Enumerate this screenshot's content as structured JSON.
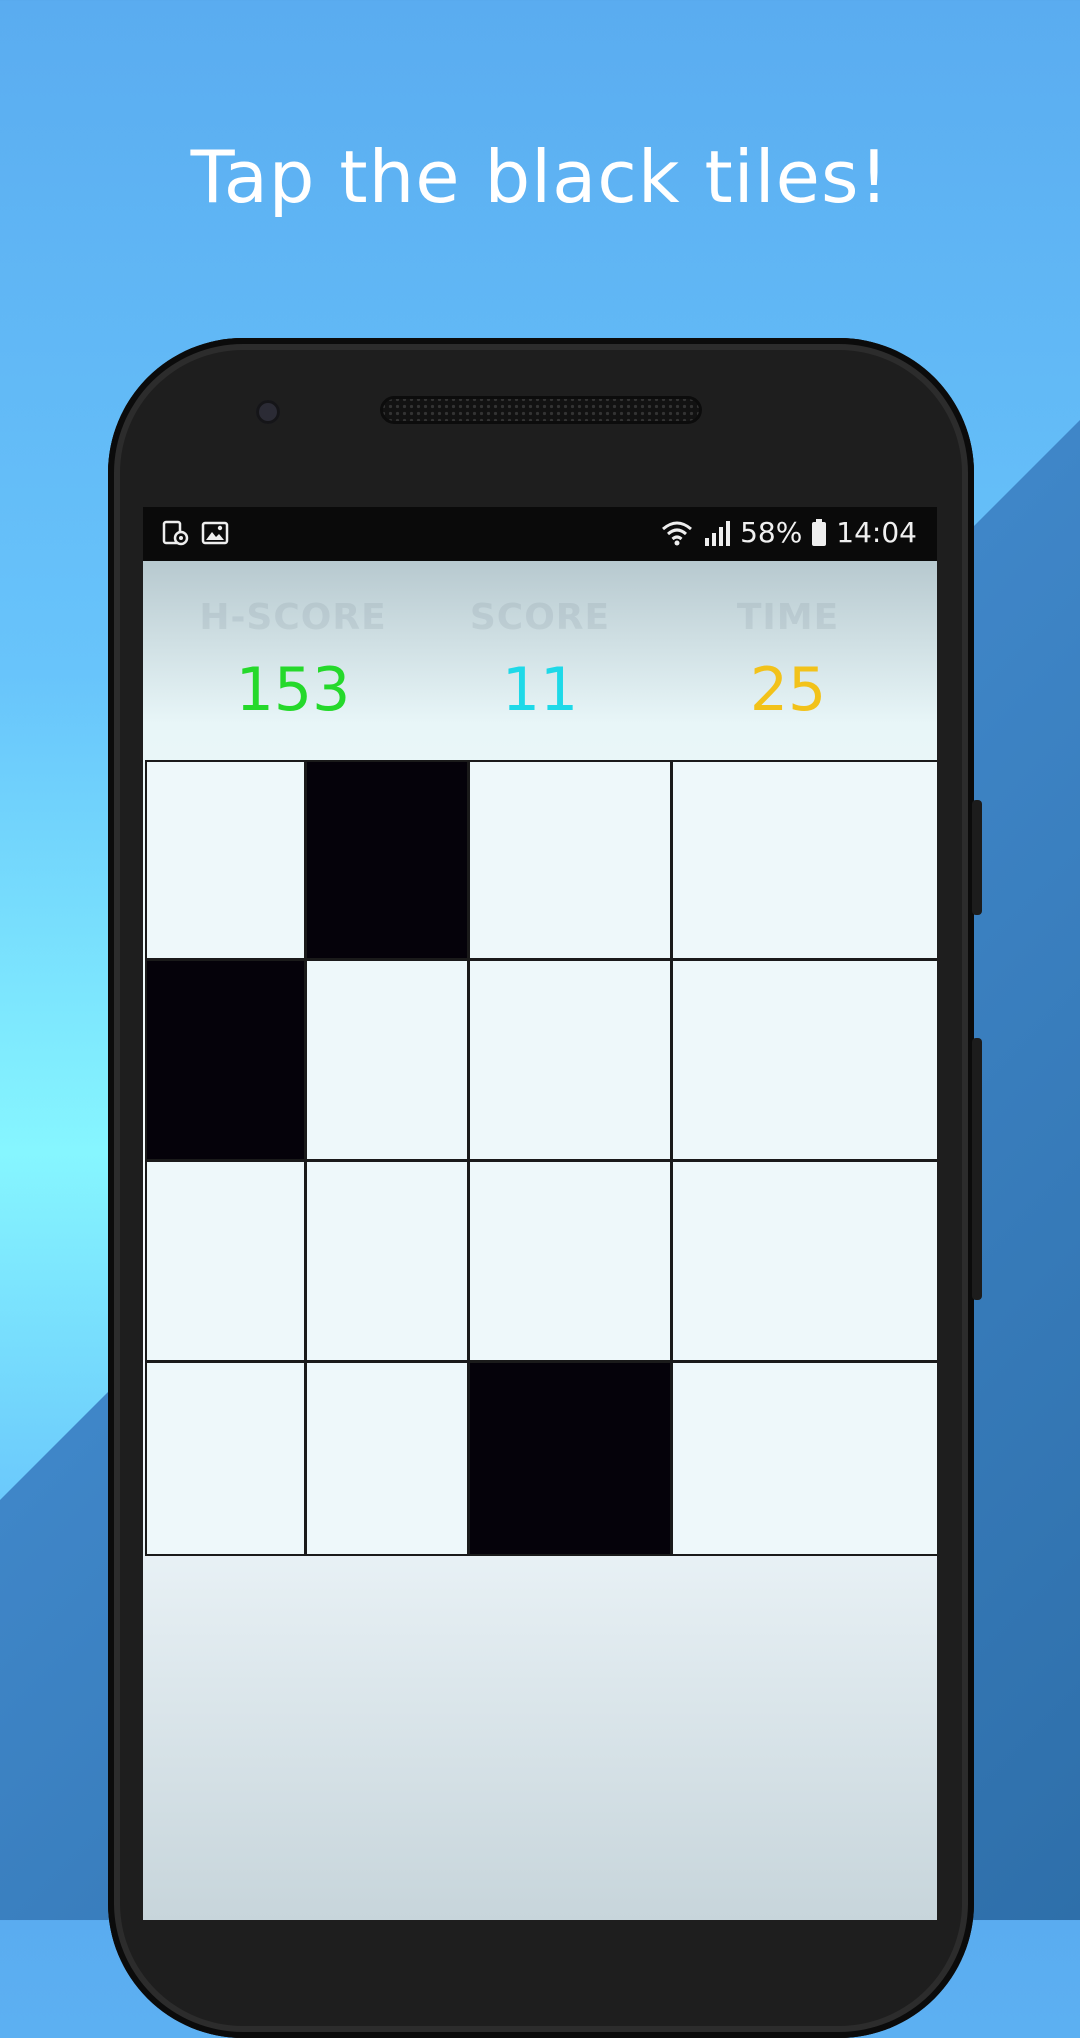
{
  "headline": "Tap the black tiles!",
  "status_bar": {
    "left_icons": [
      "screen-record-icon",
      "image-icon"
    ],
    "right_icons": [
      "wifi-icon",
      "signal-icon",
      "battery-icon"
    ],
    "battery_percent": "58%",
    "time": "14:04"
  },
  "scoreboard": {
    "hscore_label": "H-SCORE",
    "hscore_value": "153",
    "hscore_color": "#25d92b",
    "score_label": "SCORE",
    "score_value": "11",
    "score_color": "#1ed9e8",
    "time_label": "TIME",
    "time_value": "25",
    "time_color": "#f2c21a"
  },
  "grid": {
    "rows": 4,
    "cols": 4,
    "tiles": [
      [
        "white",
        "black",
        "white",
        "white"
      ],
      [
        "black",
        "white",
        "white",
        "white"
      ],
      [
        "white",
        "white",
        "white",
        "white"
      ],
      [
        "white",
        "white",
        "black",
        "white"
      ]
    ]
  },
  "colors": {
    "background_top": "#5aacf0",
    "background_mid": "#86f6ff",
    "diagonal_band": "#3f86c8",
    "phone_body": "#1e1e1e",
    "tile_black": "#05020a",
    "tile_white": "#eef8fa"
  }
}
